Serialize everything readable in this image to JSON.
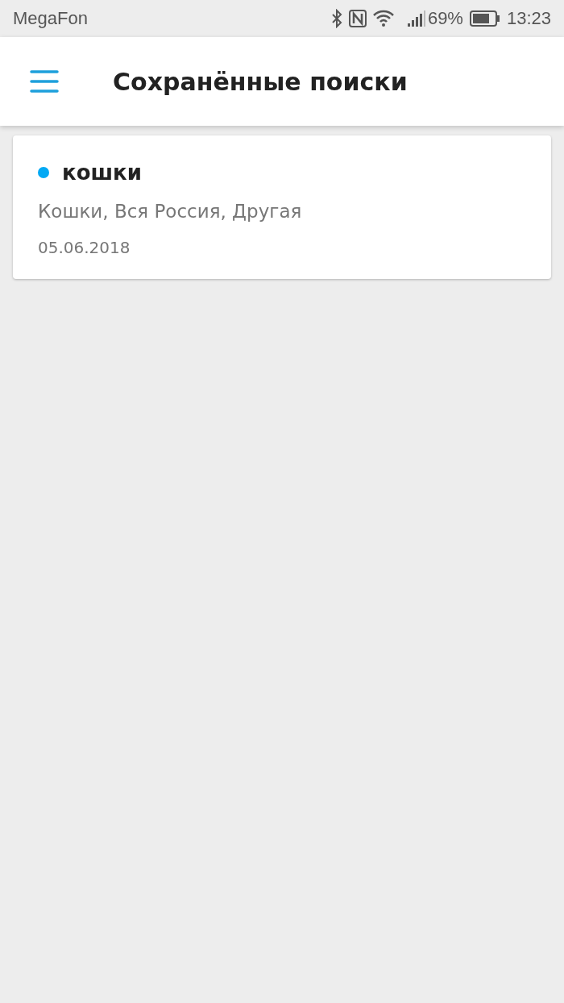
{
  "status_bar": {
    "carrier": "MegaFon",
    "battery_percent": "69%",
    "time": "13:23"
  },
  "app_bar": {
    "title": "Сохранённые поиски"
  },
  "saved_searches": [
    {
      "title": "кошки",
      "has_new": true,
      "filters": "Кошки, Вся Россия, Другая",
      "date": "05.06.2018"
    }
  ]
}
